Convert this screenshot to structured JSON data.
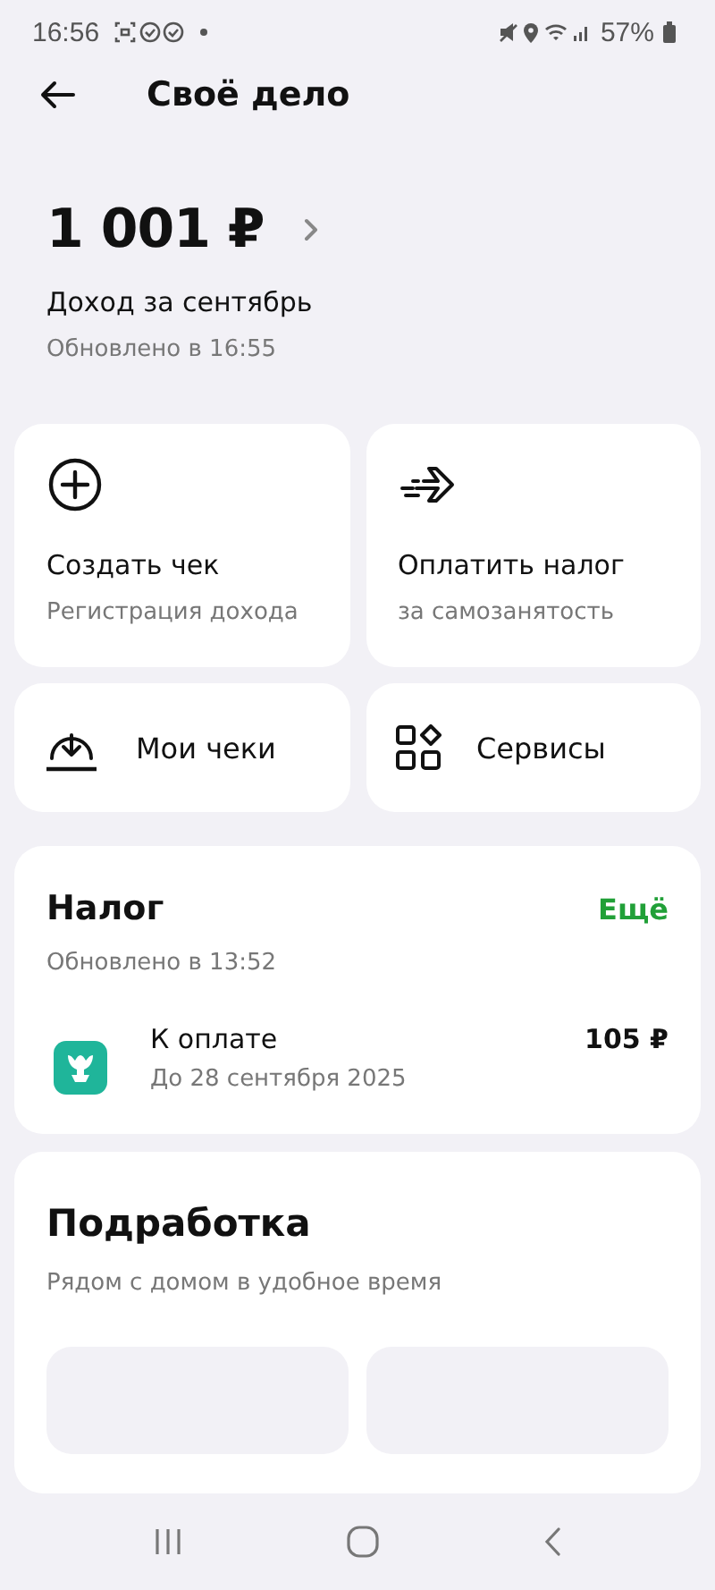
{
  "status_bar": {
    "time": "16:56",
    "battery": "57%"
  },
  "header": {
    "title": "Своё дело"
  },
  "income": {
    "amount": "1 001 ₽",
    "label": "Доход за сентябрь",
    "updated": "Обновлено в 16:55"
  },
  "tiles": [
    {
      "kind": "large",
      "title": "Создать чек",
      "subtitle": "Регистрация дохода"
    },
    {
      "kind": "large",
      "title": "Оплатить налог",
      "subtitle": "за самозанятость"
    },
    {
      "kind": "small",
      "title": "Мои чеки"
    },
    {
      "kind": "small",
      "title": "Сервисы"
    }
  ],
  "tax": {
    "title": "Налог",
    "more": "Ещё",
    "updated": "Обновлено в 13:52",
    "item": {
      "title": "К оплате",
      "due": "До 28 сентября 2025",
      "amount": "105 ₽"
    }
  },
  "side_job": {
    "title": "Подработка",
    "subtitle": "Рядом с домом в удобное время"
  }
}
